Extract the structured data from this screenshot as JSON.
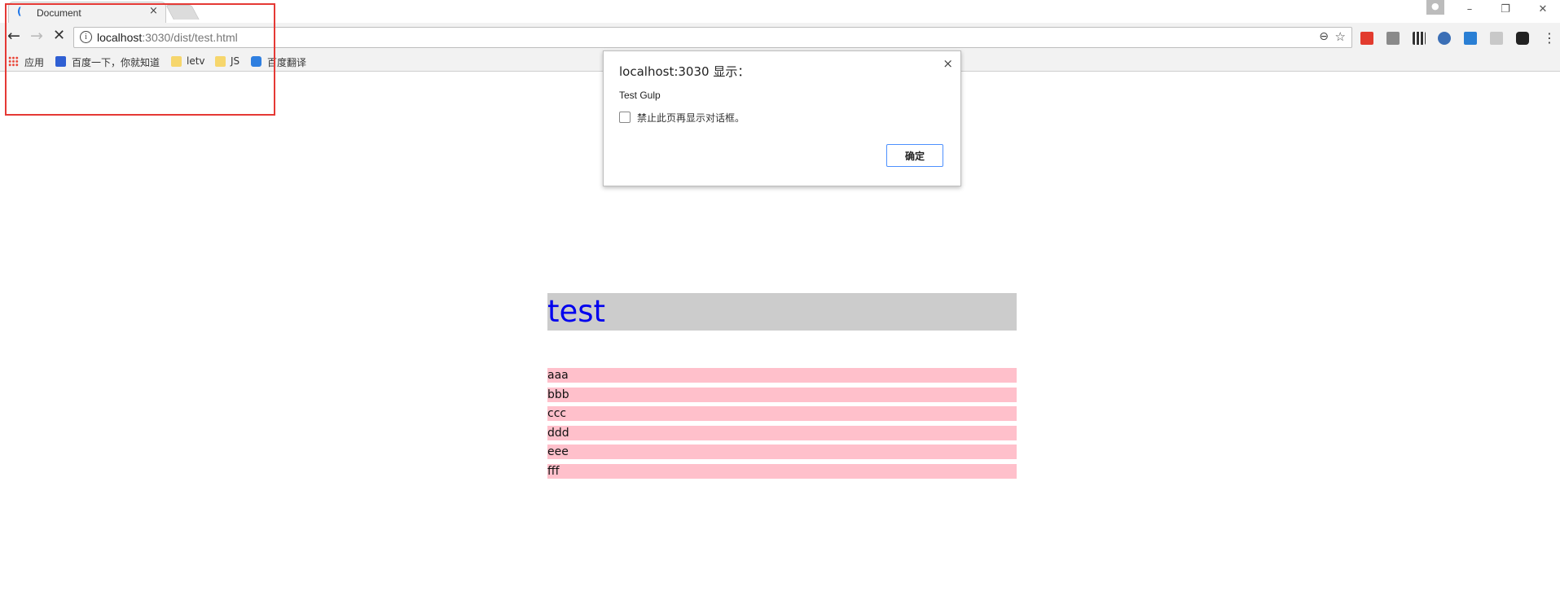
{
  "browser": {
    "tab": {
      "title": "Document",
      "close_glyph": "×",
      "favicon": "loading-spinner-icon"
    },
    "window_controls": {
      "minimize": "–",
      "restore": "❐",
      "close": "✕"
    },
    "address_bar": {
      "host": "localhost",
      "rest": ":3030/dist/test.html"
    },
    "extensions": [
      "fe-helper-icon",
      "jd-icon",
      "qr-code-icon",
      "screenshot-icon",
      "s-extension-icon",
      "reader-icon",
      "tampermonkey-icon"
    ]
  },
  "bookmarks": [
    {
      "label": "应用",
      "icon": "apps-grid-icon"
    },
    {
      "label": "百度一下，你就知道",
      "icon": "baidu-paw-icon"
    },
    {
      "label": "letv",
      "icon": "folder-icon"
    },
    {
      "label": "JS",
      "icon": "folder-icon"
    },
    {
      "label": "百度翻译",
      "icon": "translate-icon"
    }
  ],
  "dialog": {
    "title": "localhost:3030 显示：",
    "message": "Test Gulp",
    "checkbox_label": "禁止此页再显示对话框。",
    "ok_label": "确定",
    "close_glyph": "×"
  },
  "page": {
    "heading": "test",
    "items": [
      "aaa",
      "bbb",
      "ccc",
      "ddd",
      "eee",
      "fff"
    ]
  },
  "colors": {
    "heading_bg": "#cccccc",
    "heading_text": "#0000ee",
    "item_bg": "#ffc0cb",
    "annotation": "#e53935"
  }
}
